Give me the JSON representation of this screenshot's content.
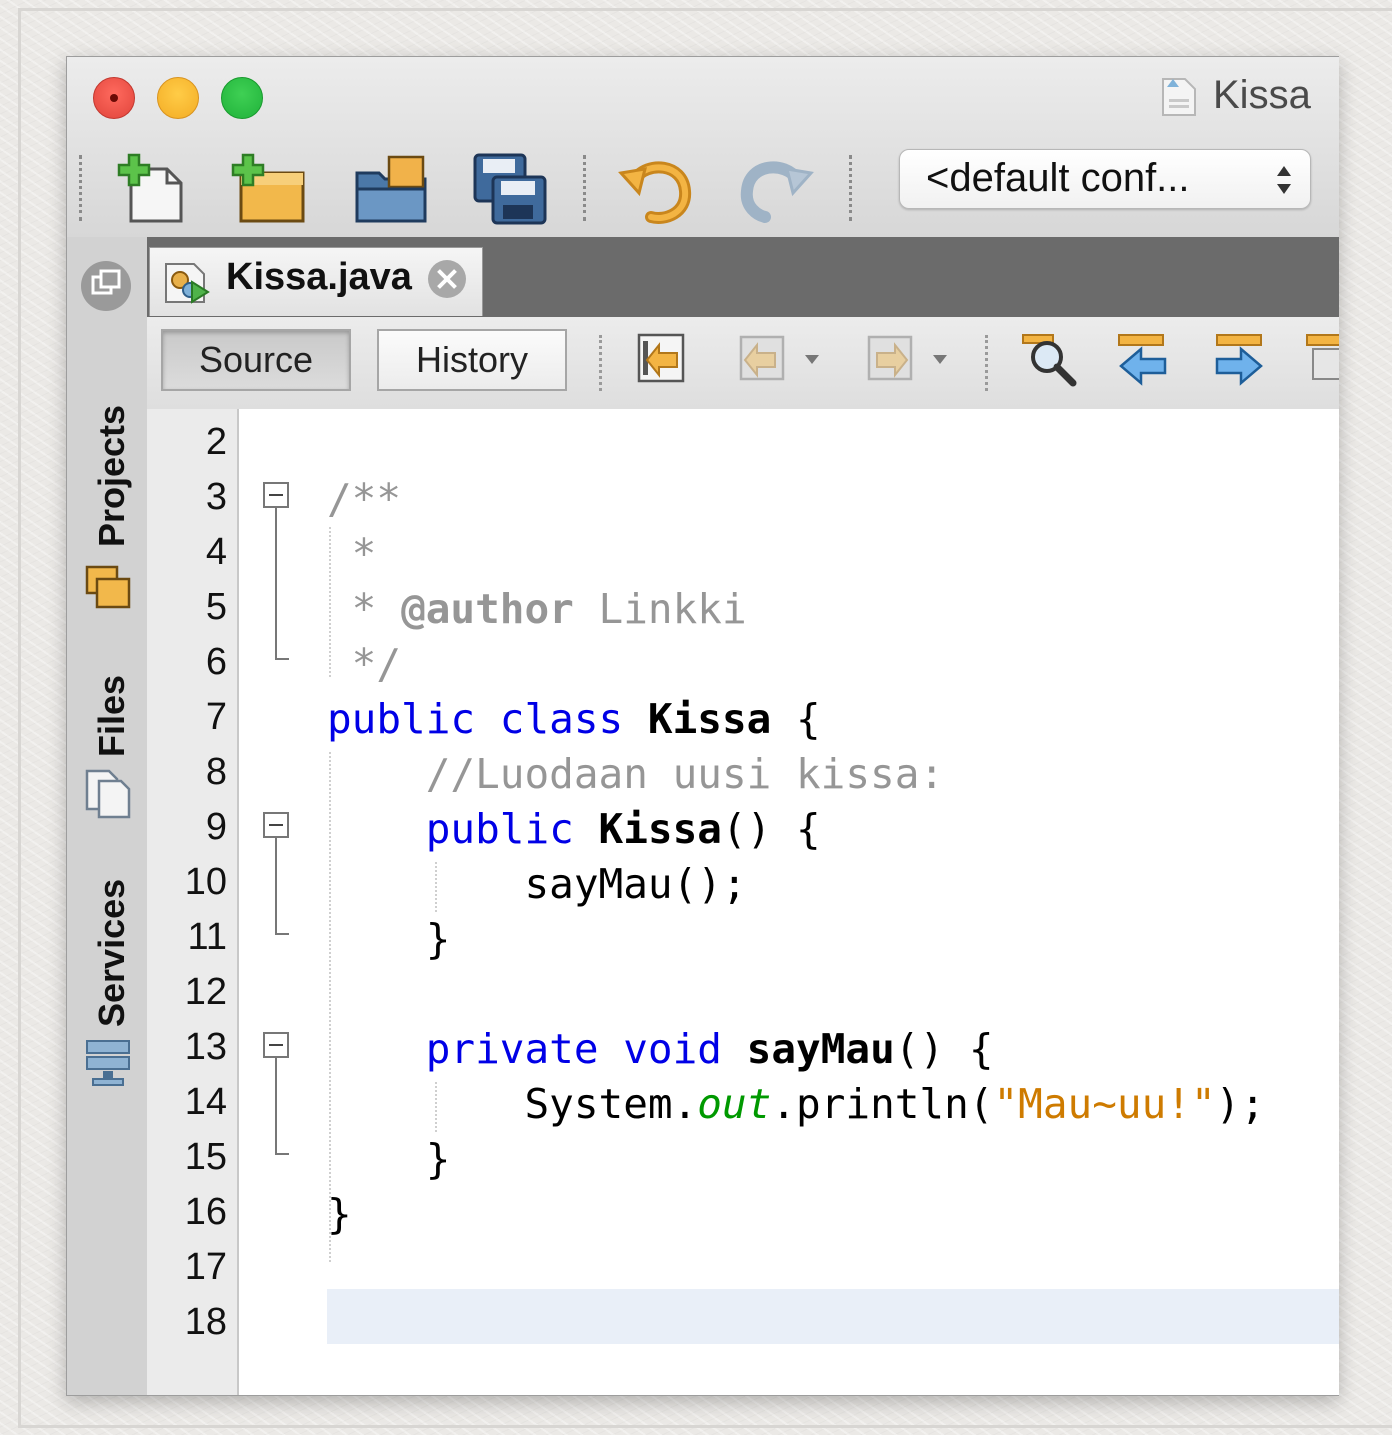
{
  "window": {
    "title": "Kissa"
  },
  "toolbar": {
    "config_value": "<default conf..."
  },
  "side_tabs": {
    "projects": "Projects",
    "files": "Files",
    "services": "Services"
  },
  "editor_tab": {
    "label": "Kissa.java"
  },
  "editor_toolbar": {
    "source_label": "Source",
    "history_label": "History"
  },
  "code": {
    "line_numbers": [
      "2",
      "3",
      "4",
      "5",
      "6",
      "7",
      "8",
      "9",
      "10",
      "11",
      "12",
      "13",
      "14",
      "15",
      "16",
      "17",
      "18"
    ],
    "lines": {
      "l3": "/**",
      "l4": " *",
      "l5_a": " * ",
      "l5_tag": "@author",
      "l5_b": " Linkki",
      "l6": " */",
      "l7_kw1": "public",
      "l7_kw2": "class",
      "l7_name": "Kissa",
      "l7_rest": " {",
      "l8": "    //Luodaan uusi kissa:",
      "l9_kw": "public",
      "l9_name": "Kissa",
      "l9_rest": "() {",
      "l10": "        sayMau();",
      "l11": "    }",
      "l13_kw1": "private",
      "l13_kw2": "void",
      "l13_name": "sayMau",
      "l13_rest": "() {",
      "l14_a": "        System.",
      "l14_field": "out",
      "l14_b": ".println(",
      "l14_str": "\"Mau~uu!\"",
      "l14_c": ");",
      "l15": "    }",
      "l16": "}"
    }
  }
}
